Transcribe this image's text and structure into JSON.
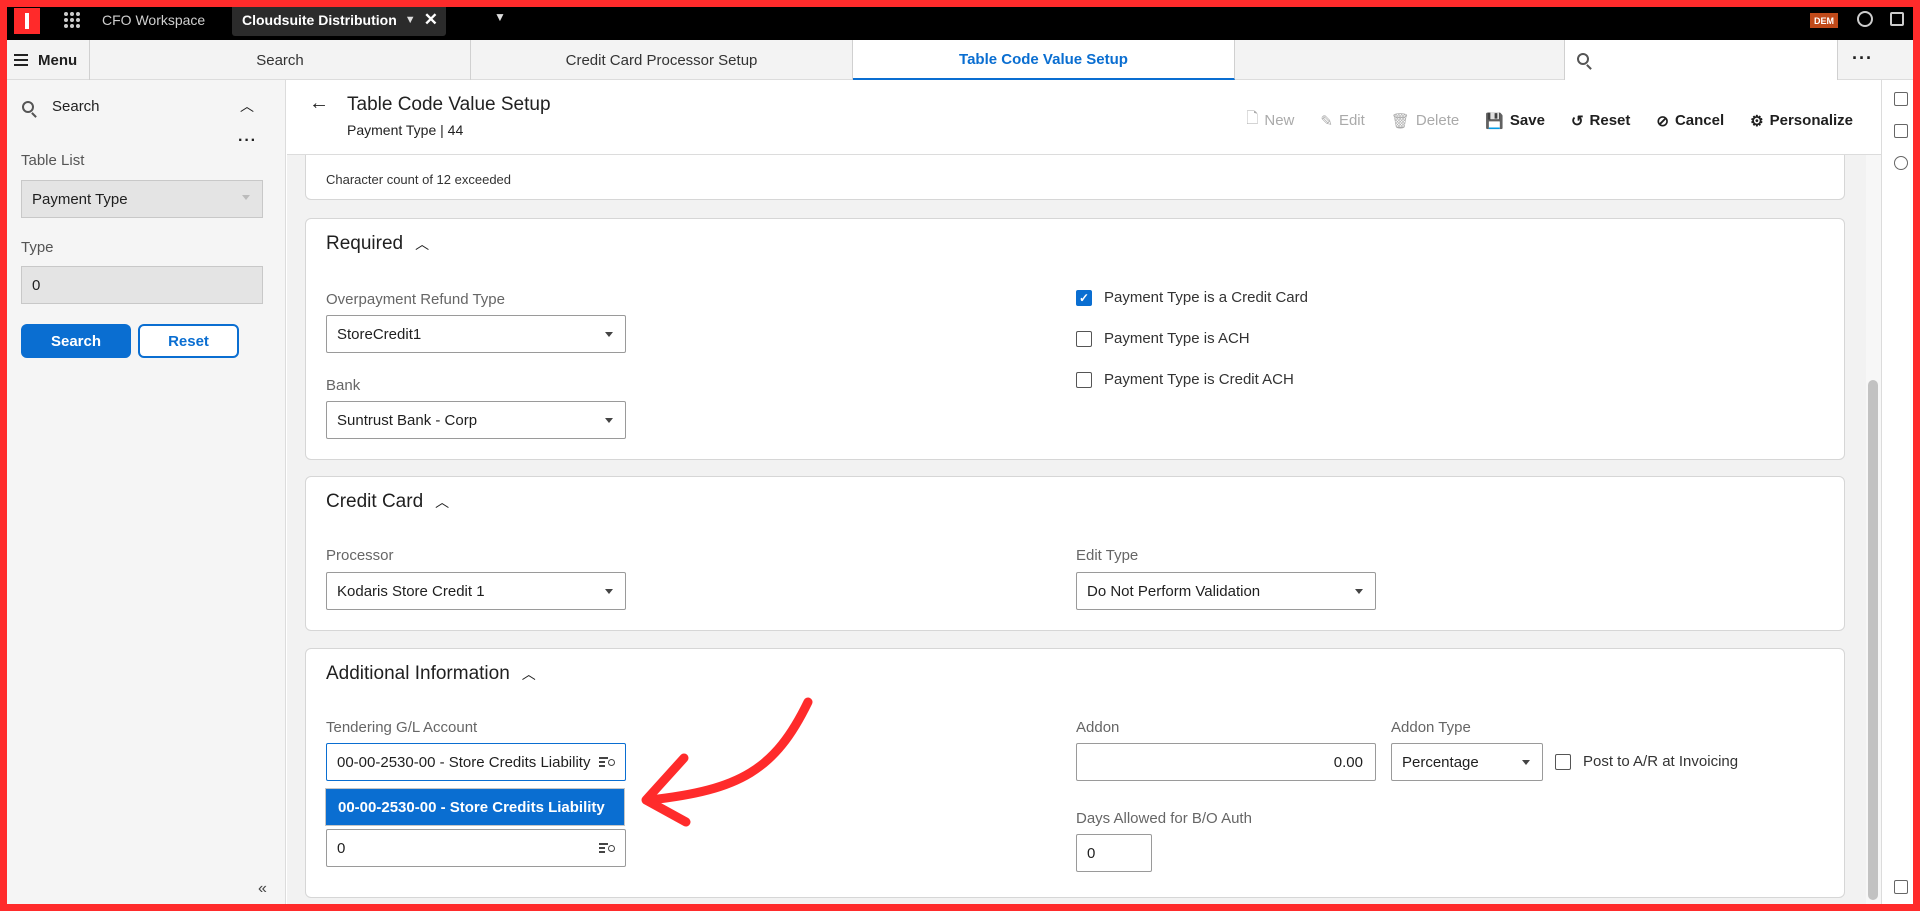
{
  "topbar": {
    "workspace": "CFO Workspace",
    "tab_title": "Cloudsuite Distribution",
    "close": "✕",
    "badge": "DEM"
  },
  "tabs": {
    "menu": "Menu",
    "items": [
      "Search",
      "Credit Card Processor Setup",
      "Table Code Value Setup"
    ]
  },
  "left_panel": {
    "title": "Search",
    "dots": "···",
    "table_list_label": "Table List",
    "table_list_value": "Payment Type",
    "type_label": "Type",
    "type_value": "0",
    "search_button": "Search",
    "reset_button": "Reset",
    "collapse": "«"
  },
  "header": {
    "back": "←",
    "title": "Table Code Value Setup",
    "subtitle": "Payment Type | 44",
    "actions": {
      "new": "New",
      "edit": "Edit",
      "delete": "Delete",
      "save": "Save",
      "reset": "Reset",
      "cancel": "Cancel",
      "personalize": "Personalize"
    }
  },
  "partial_card": {
    "message": "Character count of 12 exceeded"
  },
  "required": {
    "title": "Required",
    "overpayment_label": "Overpayment Refund Type",
    "overpayment_value": "StoreCredit1",
    "bank_label": "Bank",
    "bank_value": "Suntrust Bank - Corp",
    "cb_credit_card": "Payment Type is a Credit Card",
    "cb_ach": "Payment Type is ACH",
    "cb_credit_ach": "Payment Type is Credit ACH",
    "cb_credit_card_checked": true
  },
  "credit_card": {
    "title": "Credit Card",
    "processor_label": "Processor",
    "processor_value": "Kodaris Store Credit 1",
    "edit_type_label": "Edit Type",
    "edit_type_value": "Do Not Perform Validation"
  },
  "additional": {
    "title": "Additional Information",
    "gl_label": "Tendering G/L Account",
    "gl_value": "00-00-2530-00 - Store Credits Liability",
    "gl_suggestion": "00-00-2530-00 - Store Credits Liability",
    "second_value": "0",
    "addon_label": "Addon",
    "addon_value": "0.00",
    "addon_type_label": "Addon Type",
    "addon_type_value": "Percentage",
    "post_ar_label": "Post to A/R at Invoicing",
    "days_label": "Days Allowed for B/O Auth",
    "days_value": "0"
  },
  "colors": {
    "accent": "#0a6ed1",
    "annotation": "#ff2b2b"
  }
}
